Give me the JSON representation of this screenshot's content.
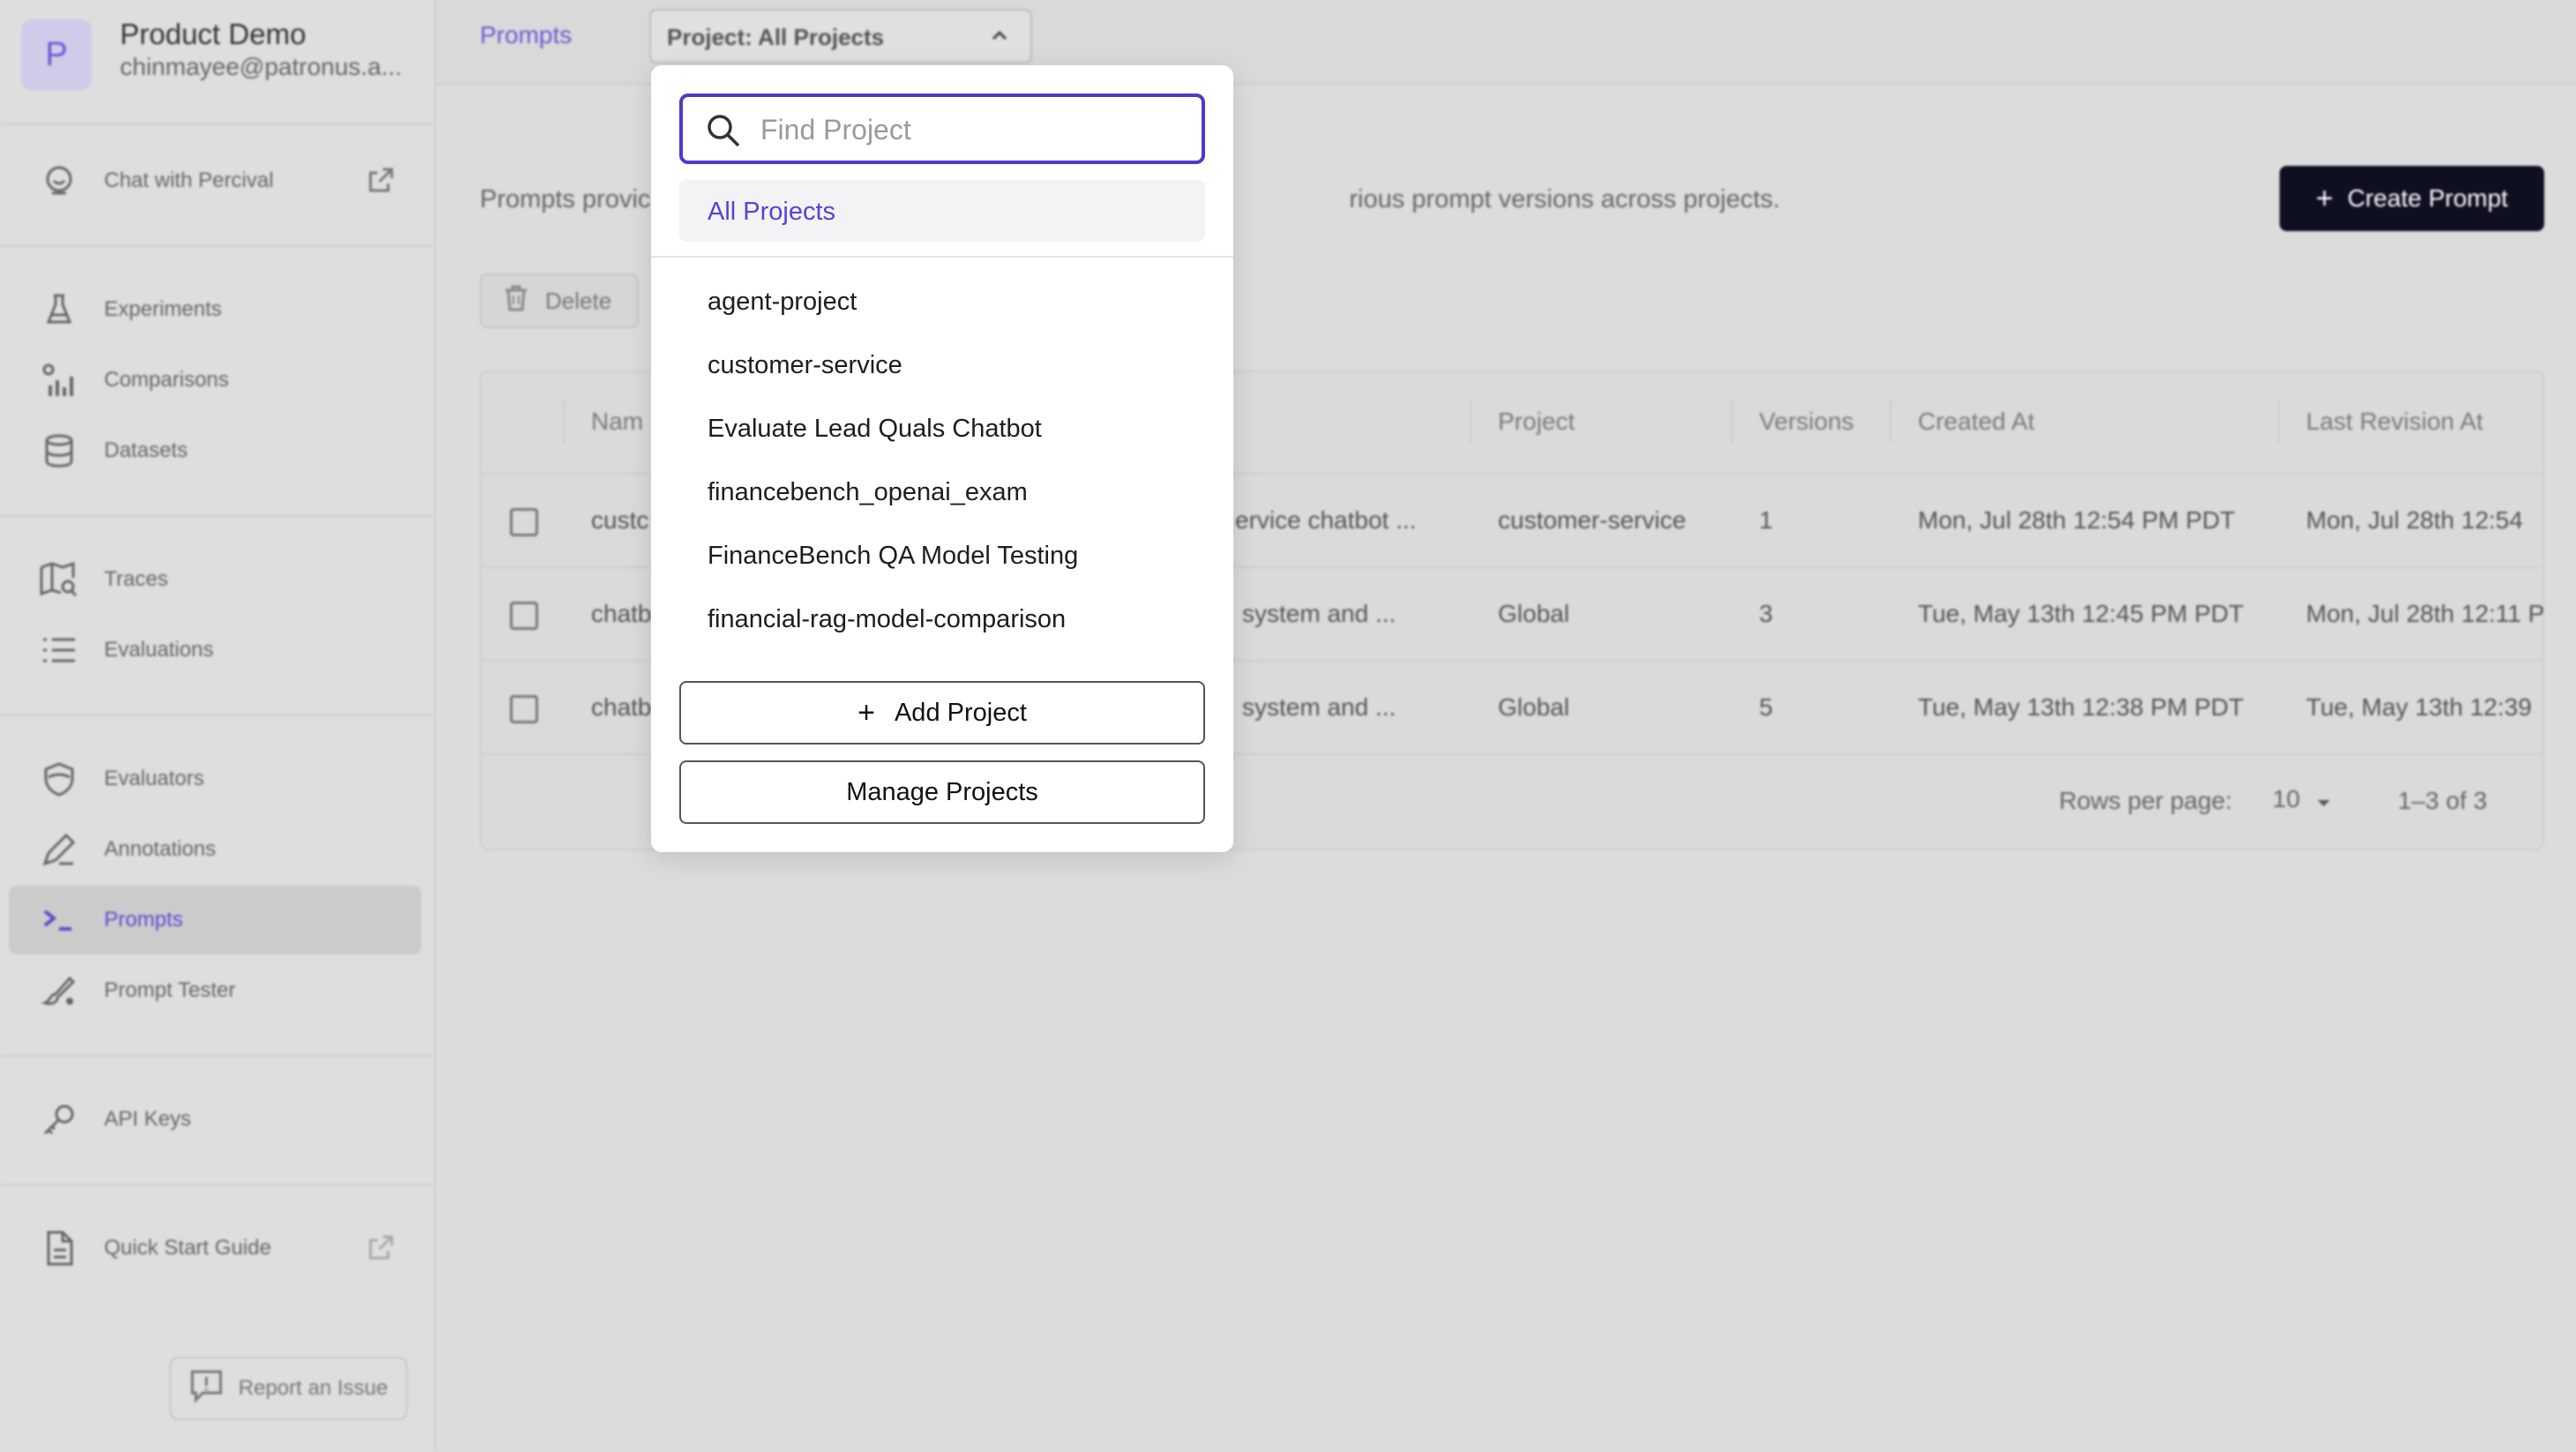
{
  "workspace": {
    "initial": "P",
    "name": "Product Demo",
    "email": "chinmayee@patronus.a..."
  },
  "sidebar": {
    "items": [
      {
        "label": "Chat with Percival"
      },
      {
        "label": "Experiments"
      },
      {
        "label": "Comparisons"
      },
      {
        "label": "Datasets"
      },
      {
        "label": "Traces"
      },
      {
        "label": "Evaluations"
      },
      {
        "label": "Evaluators"
      },
      {
        "label": "Annotations"
      },
      {
        "label": "Prompts"
      },
      {
        "label": "Prompt Tester"
      },
      {
        "label": "API Keys"
      },
      {
        "label": "Quick Start Guide"
      }
    ],
    "active_item": "Prompts",
    "report_label": "Report an Issue"
  },
  "topbar": {
    "breadcrumb": "Prompts",
    "project_selector": "Project: All Projects"
  },
  "main": {
    "description_left": "Prompts provic",
    "description_right": "rious prompt versions across projects.",
    "create_label": "Create Prompt",
    "delete_label": "Delete"
  },
  "table": {
    "headers": {
      "name": "Nam",
      "project": "Project",
      "versions": "Versions",
      "created": "Created At",
      "revised": "Last Revision At"
    },
    "rows": [
      {
        "name": "custc",
        "desc": "ervice chatbot ...",
        "project": "customer-service",
        "versions": "1",
        "created": "Mon, Jul 28th 12:54 PM PDT",
        "revised": "Mon, Jul 28th 12:54"
      },
      {
        "name": "chatb",
        "desc": "system and ...",
        "project": "Global",
        "versions": "3",
        "created": "Tue, May 13th 12:45 PM PDT",
        "revised": "Mon, Jul 28th 12:11 P"
      },
      {
        "name": "chatb",
        "desc": "system and ...",
        "project": "Global",
        "versions": "5",
        "created": "Tue, May 13th 12:38 PM PDT",
        "revised": "Tue, May 13th 12:39"
      }
    ],
    "footer": {
      "rows_per_page_label": "Rows per page:",
      "rows_per_page_value": "10",
      "range": "1–3 of 3"
    }
  },
  "dropdown": {
    "search_placeholder": "Find Project",
    "search_value": "",
    "selected": "All Projects",
    "projects": [
      "agent-project",
      "customer-service",
      "Evaluate Lead Quals Chatbot",
      "financebench_openai_exam",
      "FinanceBench QA Model Testing",
      "financial-rag-model-comparison"
    ],
    "add_label": "Add Project",
    "manage_label": "Manage Projects"
  },
  "colors": {
    "accent": "#5544d2",
    "primary_button": "#0f0f22",
    "backdrop": "#dcdcdc"
  }
}
